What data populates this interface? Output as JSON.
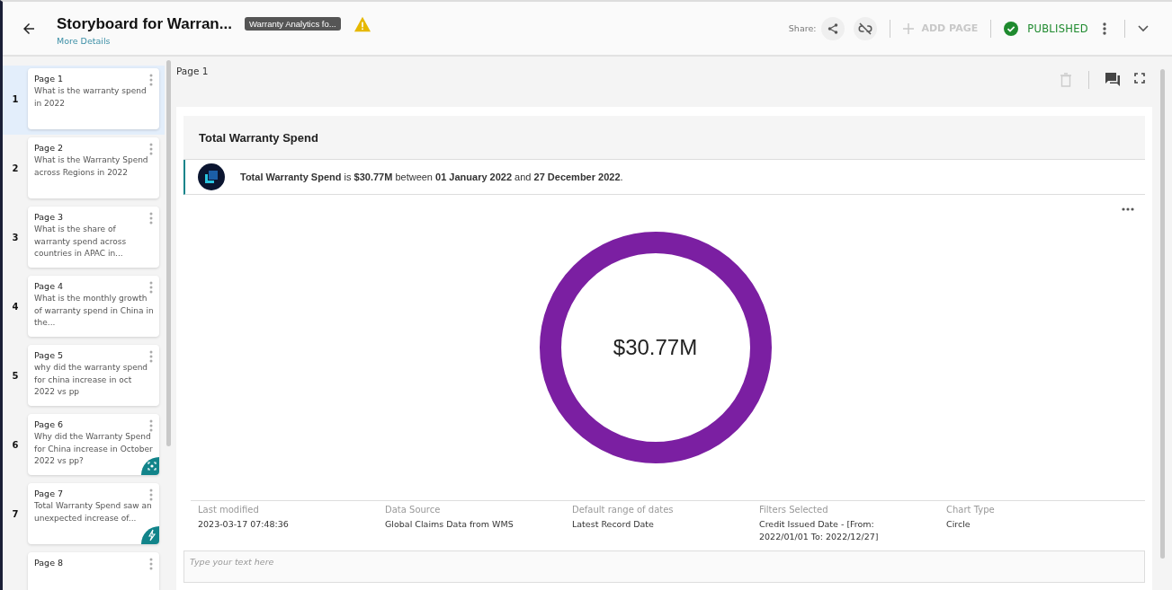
{
  "header": {
    "title": "Storyboard for Warran...",
    "details_link": "More Details",
    "tag": "Warranty Analytics fo...",
    "share_label": "Share:",
    "add_page": {
      "label": "ADD PAGE",
      "disabled": true
    },
    "status": "PUBLISHED"
  },
  "pages": [
    {
      "kind": "plain",
      "number": "1",
      "title": "Page 1",
      "text": "What is the warranty spend in 2022",
      "selected": true
    },
    {
      "kind": "plain",
      "number": "2",
      "title": "Page 2",
      "text": "What is the Warranty Spend across Regions in 2022",
      "selected": false
    },
    {
      "kind": "plain",
      "number": "3",
      "title": "Page 3",
      "text": "What is the share of warranty spend across countries in APAC in...",
      "selected": false
    },
    {
      "kind": "plain",
      "number": "4",
      "title": "Page 4",
      "text": "What is the monthly growth of warranty spend in China in the...",
      "selected": false
    },
    {
      "kind": "plain",
      "number": "5",
      "title": "Page 5",
      "text": "why did the warranty spend for china increase in oct 2022 vs pp",
      "selected": false
    },
    {
      "kind": "focus",
      "number": "6",
      "title": "Page 6",
      "text": "Why did the Warranty Spend for China increase in October 2022 vs pp?",
      "selected": false
    },
    {
      "kind": "bolt",
      "number": "7",
      "title": "Page 7",
      "text": "Total Warranty Spend saw an unexpected increase of...",
      "selected": false
    },
    {
      "kind": "plain",
      "title": "Page 8",
      "selected": false
    }
  ],
  "main": {
    "page_label": "Page 1",
    "delete_disabled": true,
    "card": {
      "title": "Total Warranty Spend",
      "insight": "**Total Warranty Spend** is **$30.77M** between **01 January 2022** and **27 December 2022**.",
      "donut_value": "$30.77M",
      "meta": [
        {
          "label": "Last modified",
          "value": "2023-03-17 07:48:36"
        },
        {
          "label": "Data Source",
          "value": "Global Claims Data from WMS"
        },
        {
          "label": "Default range of dates",
          "value": "Latest Record Date"
        },
        {
          "label": "Filters Selected",
          "value": "Credit Issued Date - [From: 2022/01/01 To: 2022/12/27]"
        },
        {
          "label": "Chart Type",
          "value": "Circle"
        }
      ],
      "note_placeholder": "Type your text here"
    }
  }
}
